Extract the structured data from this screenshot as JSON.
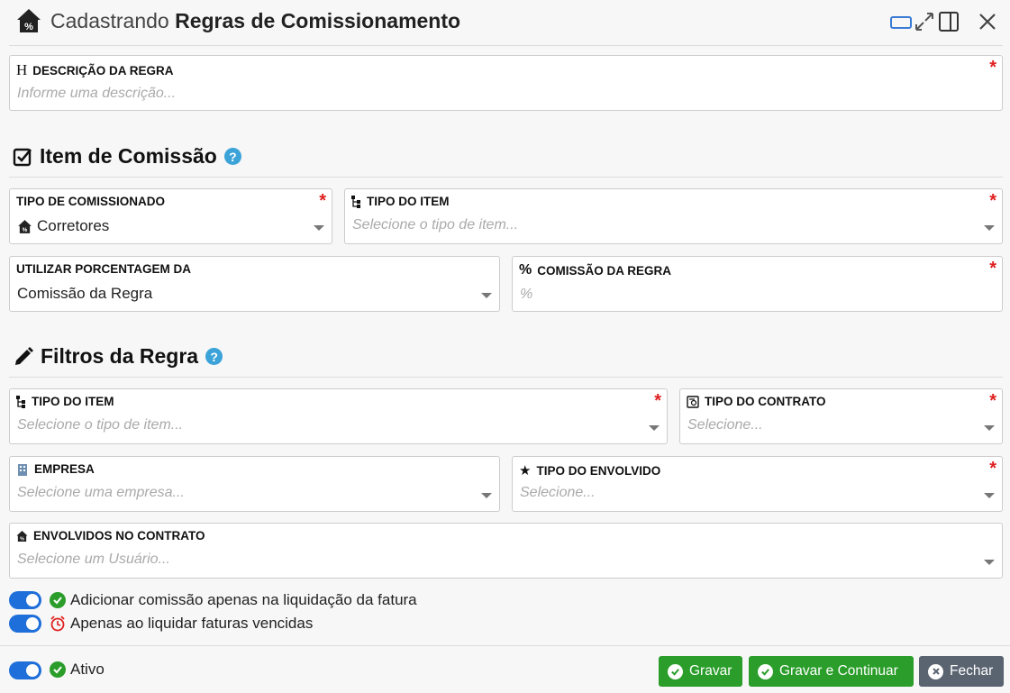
{
  "header": {
    "prefix": "Cadastrando",
    "title": "Regras de Comissionamento"
  },
  "descricao": {
    "label": "DESCRIÇÃO DA REGRA",
    "placeholder": "Informe uma descrição..."
  },
  "item_section": {
    "title": "Item de Comissão",
    "help": "?"
  },
  "tipo_comissionado": {
    "label": "TIPO DE COMISSIONADO",
    "value": "Corretores"
  },
  "tipo_item_1": {
    "label": "TIPO DO ITEM",
    "placeholder": "Selecione o tipo de item..."
  },
  "utilizar_porcentagem": {
    "label": "UTILIZAR PORCENTAGEM DA",
    "value": "Comissão da Regra"
  },
  "comissao_regra": {
    "label": "COMISSÃO DA REGRA",
    "placeholder": "%"
  },
  "filtros_section": {
    "title": "Filtros da Regra",
    "help": "?"
  },
  "tipo_item_2": {
    "label": "TIPO DO ITEM",
    "placeholder": "Selecione o tipo de item..."
  },
  "tipo_contrato": {
    "label": "TIPO DO CONTRATO",
    "placeholder": "Selecione..."
  },
  "empresa": {
    "label": "EMPRESA",
    "placeholder": "Selecione uma empresa..."
  },
  "tipo_envolvido": {
    "label": "TIPO DO ENVOLVIDO",
    "placeholder": "Selecione..."
  },
  "envolvidos": {
    "label": "ENVOLVIDOS NO CONTRATO",
    "placeholder": "Selecione um Usuário..."
  },
  "toggles": {
    "liquidacao": "Adicionar comissão apenas na liquidação da fatura",
    "vencidas": "Apenas ao liquidar faturas vencidas",
    "ativo": "Ativo"
  },
  "buttons": {
    "gravar": "Gravar",
    "gravar_continuar": "Gravar e Continuar",
    "fechar": "Fechar"
  },
  "colors": {
    "accent_blue": "#1e6fd9",
    "success_green": "#2a9d2a",
    "help_blue": "#3ba3d8",
    "required_red": "#e02020",
    "close_gray": "#5a6370"
  },
  "icons": [
    "house-percent-icon",
    "restore-window-icon",
    "expand-icon",
    "side-panel-icon",
    "close-icon",
    "heading-icon",
    "checkbox-icon",
    "help-icon",
    "hierarchy-icon",
    "percent-icon",
    "pencil-icon",
    "contract-icon",
    "building-icon",
    "star-icon",
    "check-circle-icon",
    "alarm-clock-icon",
    "times-circle-icon",
    "caret-down-icon"
  ]
}
